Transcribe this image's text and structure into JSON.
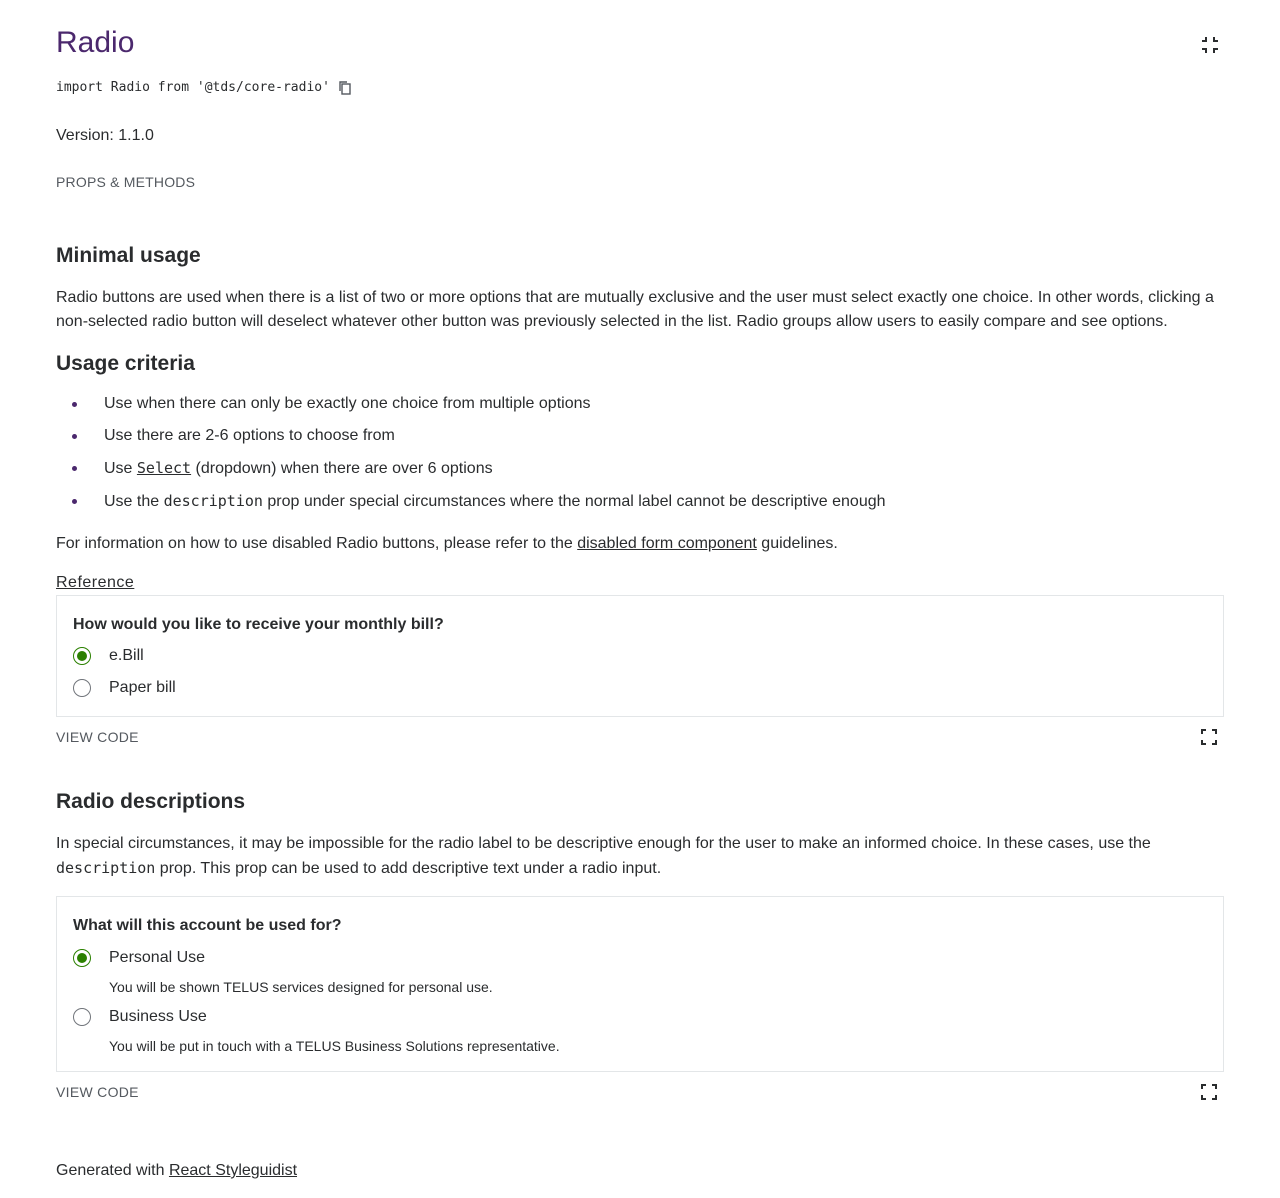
{
  "header": {
    "title": "Radio",
    "import_statement": "import Radio from '@tds/core-radio'",
    "version": "Version: 1.1.0",
    "props_link": "PROPS & METHODS"
  },
  "minimal_usage": {
    "heading": "Minimal usage",
    "text": "Radio buttons are used when there is a list of two or more options that are mutually exclusive and the user must select exactly one choice. In other words, clicking a non-selected radio button will deselect whatever other button was previously selected in the list. Radio groups allow users to easily compare and see options."
  },
  "usage_criteria": {
    "heading": "Usage criteria",
    "items": [
      {
        "text": "Use when there can only be exactly one choice from multiple options"
      },
      {
        "text": "Use there are 2-6 options to choose from"
      },
      {
        "before": "Use ",
        "code": "Select",
        "after": " (dropdown) when there are over 6 options"
      },
      {
        "before": "Use the ",
        "code": "description",
        "after": " prop under special circumstances where the normal label cannot be descriptive enough"
      }
    ],
    "disabled_before": "For information on how to use disabled Radio buttons, please refer to the ",
    "disabled_link": "disabled form component",
    "disabled_after": " guidelines.",
    "reference_link": "Reference"
  },
  "example1": {
    "legend": "How would you like to receive your monthly bill?",
    "options": [
      {
        "label": "e.Bill",
        "checked": true
      },
      {
        "label": "Paper bill",
        "checked": false
      }
    ],
    "view_code": "VIEW CODE"
  },
  "radio_descriptions": {
    "heading": "Radio descriptions",
    "text_before": "In special circumstances, it may be impossible for the radio label to be descriptive enough for the user to make an informed choice. In these cases, use the ",
    "text_code": "description",
    "text_after": " prop. This prop can be used to add descriptive text under a radio input."
  },
  "example2": {
    "legend": "What will this account be used for?",
    "options": [
      {
        "label": "Personal Use",
        "description": "You will be shown TELUS services designed for personal use.",
        "checked": true
      },
      {
        "label": "Business Use",
        "description": "You will be put in touch with a TELUS Business Solutions representative.",
        "checked": false
      }
    ],
    "view_code": "VIEW CODE"
  },
  "footer": {
    "text": "Generated with ",
    "link": "React Styleguidist"
  },
  "colors": {
    "brand_purple": "#4b286d",
    "radio_green": "#2b8000",
    "text": "#2a2c2e",
    "muted": "#54595f"
  }
}
